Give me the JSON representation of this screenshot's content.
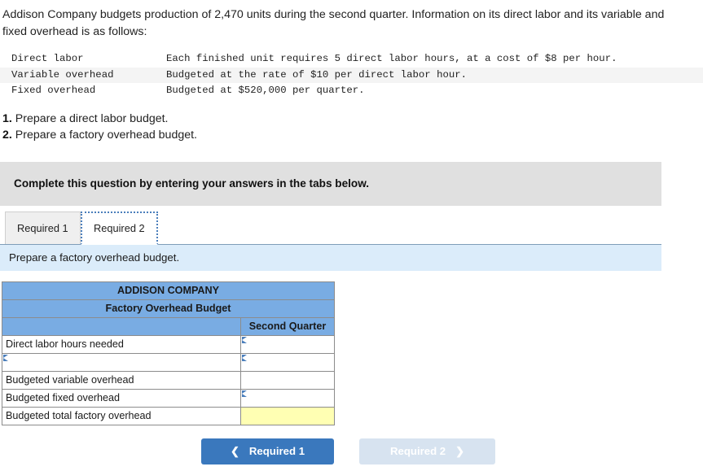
{
  "question": {
    "prose": "Addison Company budgets production of 2,470 units during the second quarter. Information on its direct labor and its variable and fixed overhead is as follows:",
    "facts": [
      {
        "term": "Direct labor",
        "detail": "Each finished unit requires 5 direct labor hours, at a cost of $8 per hour."
      },
      {
        "term": "Variable overhead",
        "detail": "Budgeted at the rate of $10 per direct labor hour."
      },
      {
        "term": "Fixed overhead",
        "detail": "Budgeted at $520,000 per quarter."
      }
    ],
    "requirements": [
      {
        "num": "1.",
        "text": "Prepare a direct labor budget."
      },
      {
        "num": "2.",
        "text": "Prepare a factory overhead budget."
      }
    ]
  },
  "banner": {
    "text": "Complete this question by entering your answers in the tabs below."
  },
  "tabs": [
    {
      "label": "Required 1",
      "active": false
    },
    {
      "label": "Required 2",
      "active": true
    }
  ],
  "instruction_bar": {
    "text": "Prepare a factory overhead budget."
  },
  "worksheet": {
    "company": "ADDISON COMPANY",
    "title": "Factory Overhead Budget",
    "blank_header": "",
    "column_header": "Second Quarter",
    "rows": [
      {
        "label": "Direct labor hours needed",
        "label_editable": false,
        "value": "",
        "value_style": "input"
      },
      {
        "label": "",
        "label_editable": true,
        "value": "",
        "value_style": "input"
      },
      {
        "label": "Budgeted variable overhead",
        "label_editable": false,
        "value": "",
        "value_style": "plain"
      },
      {
        "label": "Budgeted fixed overhead",
        "label_editable": false,
        "value": "",
        "value_style": "input"
      },
      {
        "label": "Budgeted total factory overhead",
        "label_editable": false,
        "value": "",
        "value_style": "total"
      }
    ]
  },
  "navigation": {
    "prev_label": "Required 1",
    "prev_icon": "chevron-left-icon",
    "next_label": "Required 2",
    "next_icon": "chevron-right-icon"
  },
  "colors": {
    "header_blue": "#79ACE3",
    "banner_gray": "#E0E0E0",
    "instruction_blue": "#DBECFA",
    "input_border_blue": "#5B8DC0",
    "total_yellow": "#FFFFB3",
    "button_blue": "#3A78BD",
    "button_disabled": "#D7E3F0"
  }
}
